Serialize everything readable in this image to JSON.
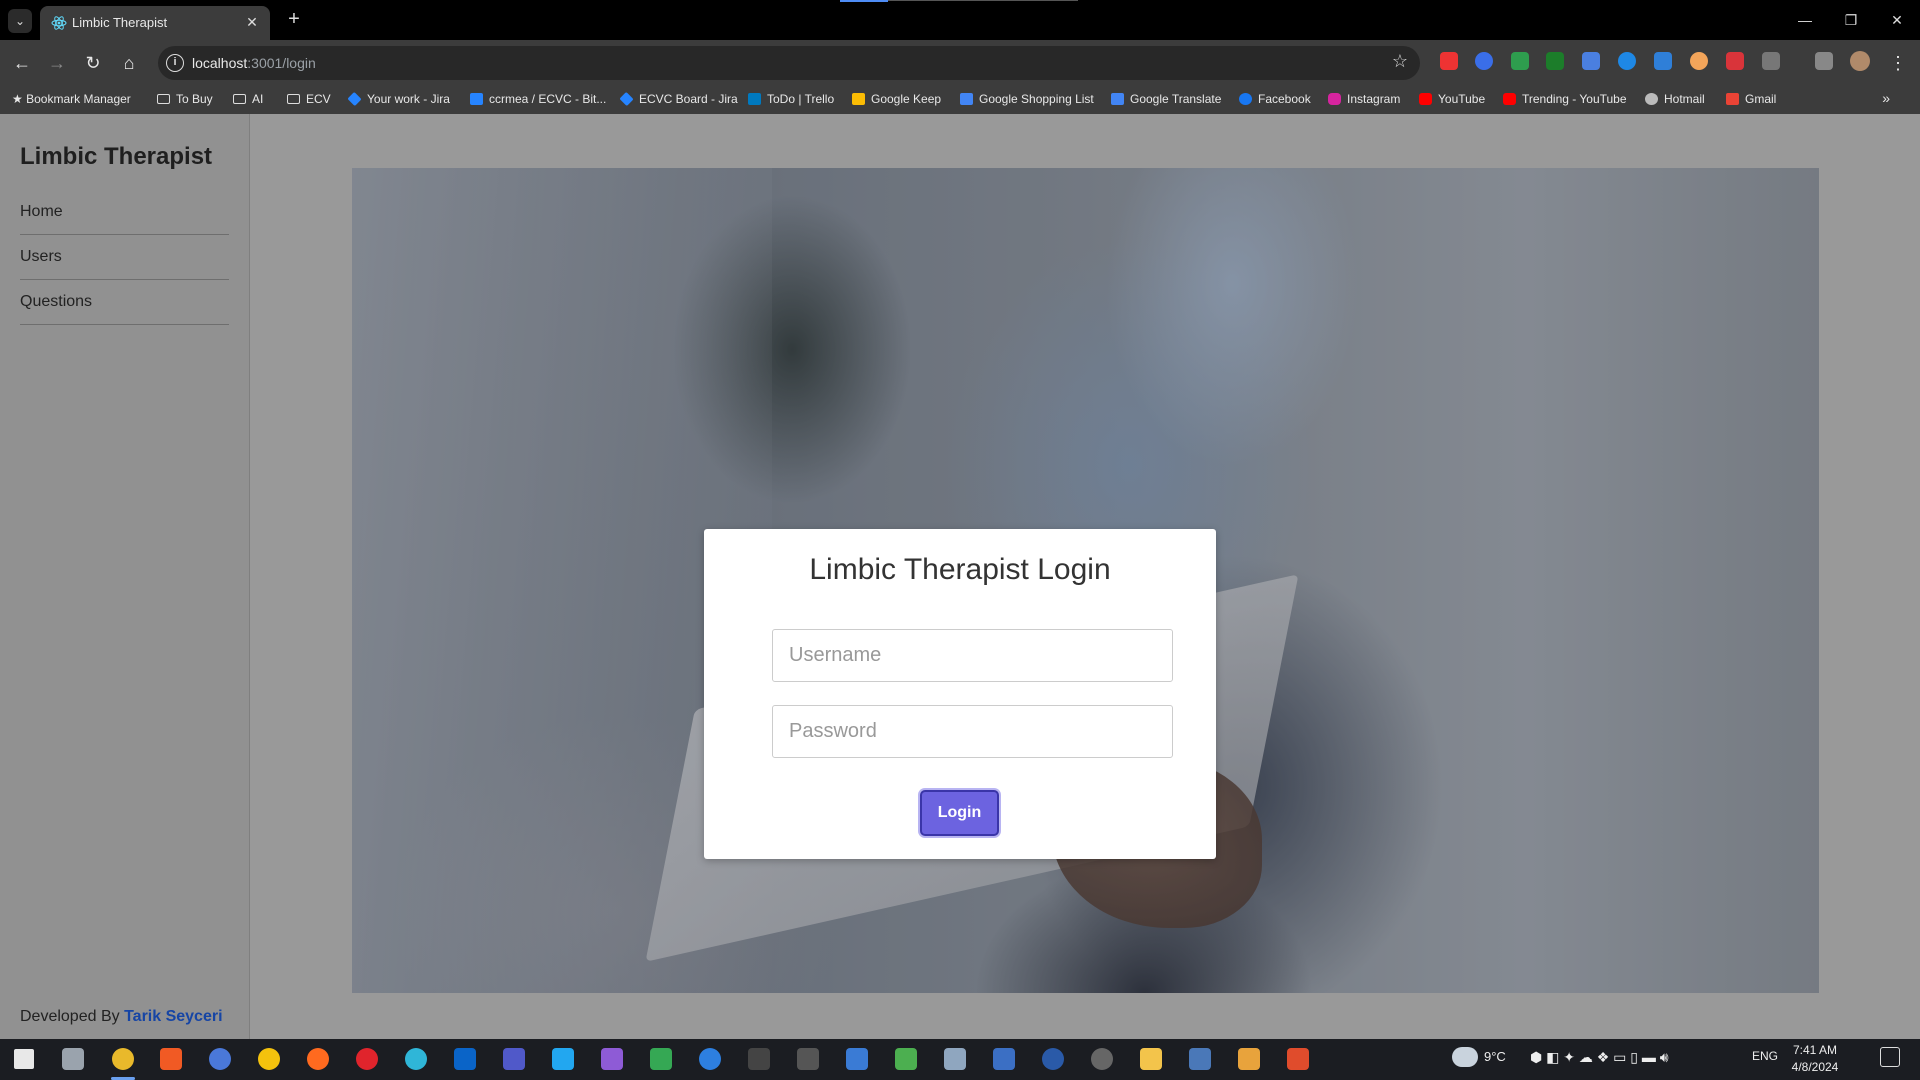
{
  "browser": {
    "tab_title": "Limbic Therapist",
    "tab_close": "✕",
    "new_tab": "+",
    "url_host": "localhost",
    "url_rest": ":3001/login",
    "window_controls": {
      "minimize": "—",
      "restore": "❐",
      "close": "✕"
    },
    "bookmarks": [
      {
        "label": "Bookmark Manager",
        "icon": "star-icon"
      },
      {
        "label": "To Buy",
        "icon": "folder-icon"
      },
      {
        "label": "AI",
        "icon": "folder-icon"
      },
      {
        "label": "ECV",
        "icon": "folder-icon"
      },
      {
        "label": "Your work - Jira",
        "icon": "jira-icon"
      },
      {
        "label": "ccrmea / ECVC - Bit...",
        "icon": "bitbucket-icon"
      },
      {
        "label": "ECVC Board - Jira",
        "icon": "jira-icon"
      },
      {
        "label": "ToDo | Trello",
        "icon": "trello-icon"
      },
      {
        "label": "Google Keep",
        "icon": "keep-icon"
      },
      {
        "label": "Google Shopping List",
        "icon": "cart-icon"
      },
      {
        "label": "Google Translate",
        "icon": "translate-icon"
      },
      {
        "label": "Facebook",
        "icon": "facebook-icon"
      },
      {
        "label": "Instagram",
        "icon": "instagram-icon"
      },
      {
        "label": "YouTube",
        "icon": "youtube-icon"
      },
      {
        "label": "Trending - YouTube",
        "icon": "youtube-icon"
      },
      {
        "label": "Hotmail",
        "icon": "hotmail-icon"
      },
      {
        "label": "Gmail",
        "icon": "gmail-icon"
      }
    ],
    "bookmarks_more": "»"
  },
  "sidebar": {
    "brand": "Limbic Therapist",
    "items": [
      {
        "label": "Home"
      },
      {
        "label": "Users"
      },
      {
        "label": "Questions"
      }
    ],
    "footer_prefix": "Developed By",
    "footer_author": "Tarik Seyceri"
  },
  "login": {
    "title": "Limbic Therapist Login",
    "username_placeholder": "Username",
    "username_value": "",
    "password_placeholder": "Password",
    "password_value": "",
    "button_label": "Login"
  },
  "taskbar": {
    "weather": "9°C",
    "language": "ENG",
    "time": "7:41 AM",
    "date": "4/8/2024"
  },
  "colors": {
    "accent_button": "#6c63e0",
    "author_link": "#1645a5",
    "sidebar_bg": "#919191",
    "chrome_bg": "#3c3c3c"
  }
}
